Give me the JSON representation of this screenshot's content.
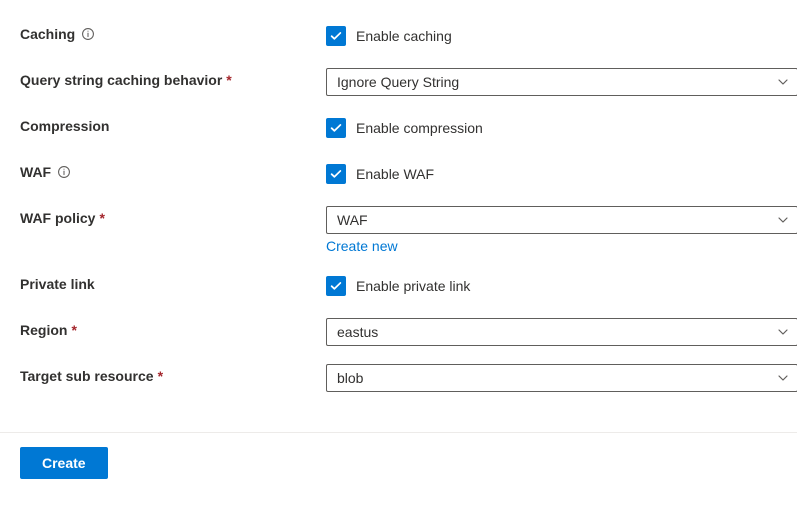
{
  "labels": {
    "caching": "Caching",
    "queryStringCaching": "Query string caching behavior",
    "compression": "Compression",
    "waf": "WAF",
    "wafPolicy": "WAF policy",
    "privateLink": "Private link",
    "region": "Region",
    "targetSubResource": "Target sub resource"
  },
  "checkboxes": {
    "enableCaching": "Enable caching",
    "enableCompression": "Enable compression",
    "enableWAF": "Enable WAF",
    "enablePrivateLink": "Enable private link"
  },
  "selects": {
    "queryStringCaching": "Ignore Query String",
    "wafPolicy": "WAF",
    "region": "eastus",
    "targetSubResource": "blob"
  },
  "links": {
    "createNew": "Create new"
  },
  "buttons": {
    "create": "Create"
  },
  "required": "*"
}
